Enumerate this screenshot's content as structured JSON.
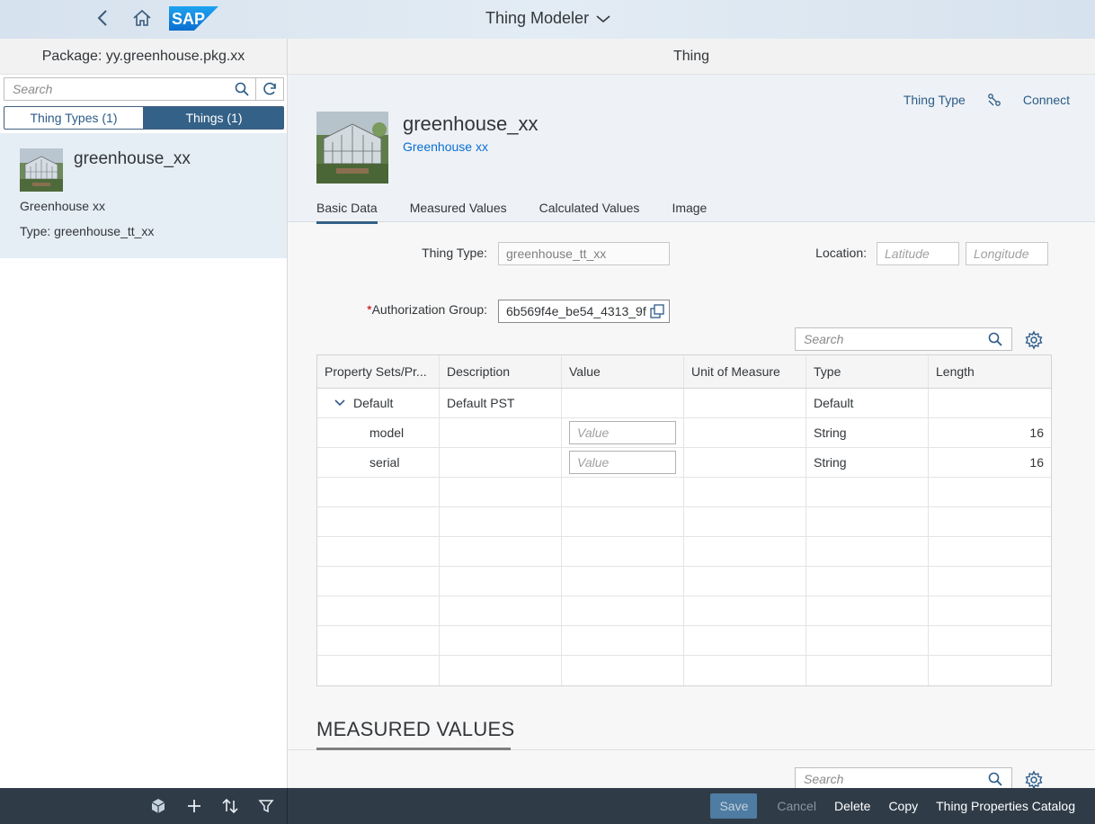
{
  "shell": {
    "title": "Thing Modeler",
    "logo_text": "SAP"
  },
  "master": {
    "header": "Package: yy.greenhouse.pkg.xx",
    "search_placeholder": "Search",
    "segments": [
      "Thing Types (1)",
      "Things (1)"
    ],
    "item": {
      "name": "greenhouse_xx",
      "description": "Greenhouse xx",
      "type": "Type: greenhouse_tt_xx"
    }
  },
  "detail": {
    "header": "Thing",
    "actions": {
      "thing_type": "Thing Type",
      "connect": "Connect"
    },
    "object": {
      "title": "greenhouse_xx",
      "subtitle": "Greenhouse xx"
    },
    "tabs": [
      "Basic Data",
      "Measured Values",
      "Calculated Values",
      "Image"
    ],
    "form": {
      "thing_type_label": "Thing Type:",
      "thing_type_value": "greenhouse_tt_xx",
      "location_label": "Location:",
      "latitude_placeholder": "Latitude",
      "longitude_placeholder": "Longitude",
      "auth_required_mark": "*",
      "auth_label": "Authorization Group:",
      "auth_value": "6b569f4e_be54_4313_9f"
    },
    "table_search_placeholder": "Search",
    "table": {
      "headers": [
        "Property Sets/Pr...",
        "Description",
        "Value",
        "Unit of Measure",
        "Type",
        "Length"
      ],
      "rows": [
        {
          "name": "Default",
          "description": "Default PST",
          "value": "",
          "unit": "",
          "type": "Default",
          "length": ""
        },
        {
          "name": "model",
          "description": "",
          "value_placeholder": "Value",
          "unit": "",
          "type": "String",
          "length": "16"
        },
        {
          "name": "serial",
          "description": "",
          "value_placeholder": "Value",
          "unit": "",
          "type": "String",
          "length": "16"
        }
      ]
    },
    "section_title": "MEASURED VALUES",
    "section_search_placeholder": "Search"
  },
  "footer": {
    "save": "Save",
    "cancel": "Cancel",
    "delete": "Delete",
    "copy": "Copy",
    "catalog": "Thing Properties Catalog"
  },
  "colors": {
    "shell_bg": "#dfe9f2",
    "accent": "#346187",
    "link": "#0a6ed1",
    "footer_bg": "#2f3c48",
    "selected_item_bg": "#e5edf5"
  }
}
